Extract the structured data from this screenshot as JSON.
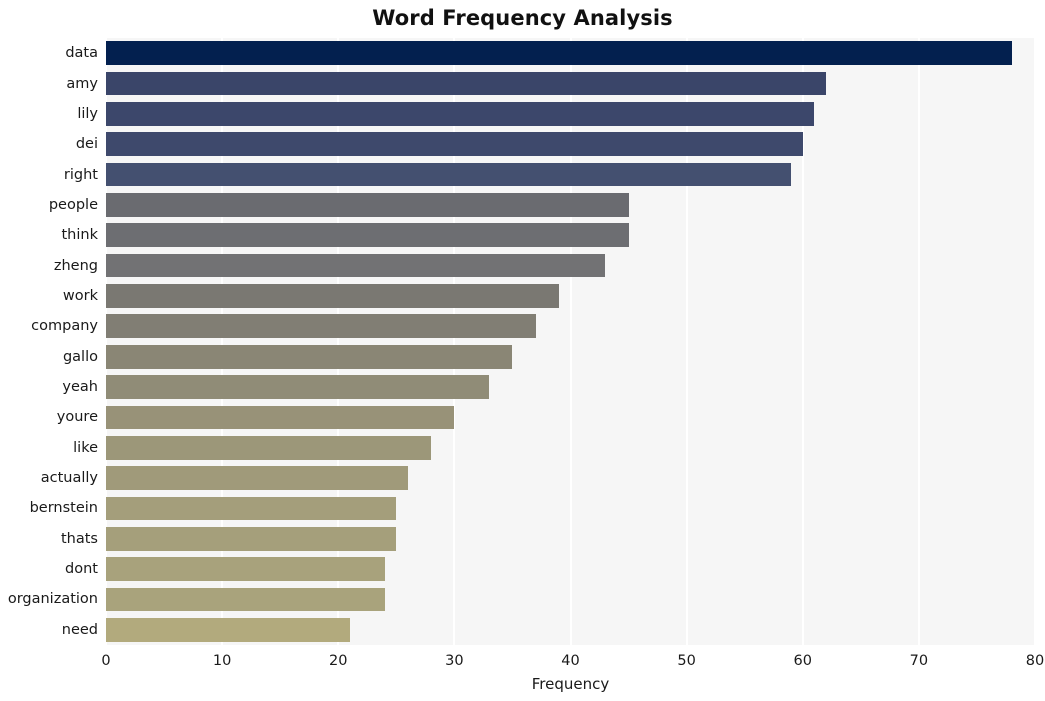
{
  "chart_data": {
    "type": "bar",
    "orientation": "horizontal",
    "title": "Word Frequency Analysis",
    "xlabel": "Frequency",
    "ylabel": "",
    "xlim": [
      0,
      80
    ],
    "ylim": [
      0,
      20
    ],
    "xticks": [
      0,
      10,
      20,
      30,
      40,
      50,
      60,
      70,
      80
    ],
    "xtick_labels": [
      "0",
      "10",
      "20",
      "30",
      "40",
      "50",
      "60",
      "70",
      "80"
    ],
    "grid": true,
    "grid_axis": "x",
    "grid_color": "#ffffff",
    "plot_background": "#f6f6f6",
    "figure_background": "#ffffff",
    "legend": null,
    "categories": [
      "data",
      "amy",
      "lily",
      "dei",
      "right",
      "people",
      "think",
      "zheng",
      "work",
      "company",
      "gallo",
      "yeah",
      "youre",
      "like",
      "actually",
      "bernstein",
      "thats",
      "dont",
      "organization",
      "need"
    ],
    "values": [
      78,
      62,
      61,
      60,
      59,
      45,
      45,
      43,
      39,
      37,
      35,
      33,
      30,
      28,
      26,
      25,
      25,
      24,
      24,
      21
    ],
    "bar_colors": [
      "#03204f",
      "#3a4569",
      "#3c476b",
      "#3e496c",
      "#445070",
      "#6a6b70",
      "#6d6e72",
      "#727274",
      "#7a7872",
      "#817e74",
      "#8a8675",
      "#908c77",
      "#989278",
      "#9c9779",
      "#a09a7a",
      "#a49e7b",
      "#a59f7b",
      "#a8a27c",
      "#a9a37c",
      "#b2aa7d"
    ],
    "colormap": "cividis_r",
    "series": [
      {
        "name": "Frequency",
        "points": [
          {
            "label": "data",
            "value": 78
          },
          {
            "label": "amy",
            "value": 62
          },
          {
            "label": "lily",
            "value": 61
          },
          {
            "label": "dei",
            "value": 60
          },
          {
            "label": "right",
            "value": 59
          },
          {
            "label": "people",
            "value": 45
          },
          {
            "label": "think",
            "value": 45
          },
          {
            "label": "zheng",
            "value": 43
          },
          {
            "label": "work",
            "value": 39
          },
          {
            "label": "company",
            "value": 37
          },
          {
            "label": "gallo",
            "value": 35
          },
          {
            "label": "yeah",
            "value": 33
          },
          {
            "label": "youre",
            "value": 30
          },
          {
            "label": "like",
            "value": 28
          },
          {
            "label": "actually",
            "value": 26
          },
          {
            "label": "bernstein",
            "value": 25
          },
          {
            "label": "thats",
            "value": 25
          },
          {
            "label": "dont",
            "value": 24
          },
          {
            "label": "organization",
            "value": 24
          },
          {
            "label": "need",
            "value": 21
          }
        ]
      }
    ]
  }
}
